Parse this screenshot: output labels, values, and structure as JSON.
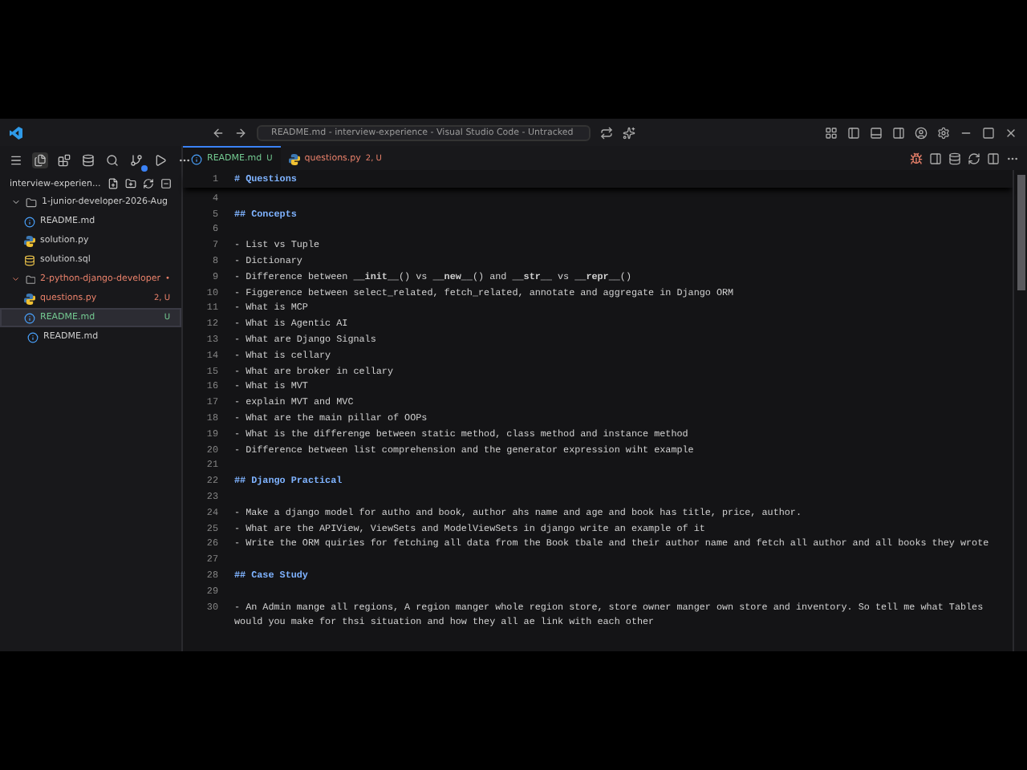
{
  "title_bar": {
    "command_center": "README.md - interview-experience - Visual Studio Code - Untracked"
  },
  "explorer": {
    "title": "interview-experien...",
    "tree": [
      {
        "name": "1-junior-developer-2026-Aug",
        "kind": "folder",
        "expanded": true,
        "selected": false,
        "children": [
          {
            "name": "README.md",
            "kind": "md",
            "selected": false
          },
          {
            "name": "solution.py",
            "kind": "py",
            "selected": false
          },
          {
            "name": "solution.sql",
            "kind": "sql",
            "selected": false
          }
        ]
      },
      {
        "name": "2-python-django-developer",
        "kind": "folder",
        "expanded": true,
        "color": "#e8806a",
        "badge": "•",
        "selected": false,
        "children": [
          {
            "name": "questions.py",
            "kind": "py",
            "color": "#e8806a",
            "badge": "2, U",
            "selected": false
          },
          {
            "name": "README.md",
            "kind": "md",
            "color": "#73c991",
            "badge": "U",
            "selected": true
          }
        ]
      },
      {
        "name": "README.md",
        "kind": "md",
        "selected": false
      }
    ]
  },
  "tabs": [
    {
      "label": "README.md",
      "badge": "U",
      "kind": "md",
      "color": "#73c991",
      "selected": true
    },
    {
      "label": "questions.py",
      "badge": "2, U",
      "kind": "py",
      "color": "#e8806a",
      "selected": false
    }
  ],
  "editor": {
    "sticky": {
      "number": "1",
      "kind": "heading",
      "text": "# Questions"
    },
    "lines": [
      {
        "number": "4",
        "kind": "blank"
      },
      {
        "number": "5",
        "kind": "heading",
        "text": "## Concepts"
      },
      {
        "number": "6",
        "kind": "blank"
      },
      {
        "number": "7",
        "kind": "text",
        "text": "- List vs Tuple"
      },
      {
        "number": "8",
        "kind": "text",
        "text": "- Dictionary"
      },
      {
        "number": "9",
        "kind": "text",
        "text": "- Difference between **__init__**() vs **__new__**() and **__str__** vs **__repr__**()"
      },
      {
        "number": "10",
        "kind": "text",
        "text": "- Figgerence between select_related, fetch_related, annotate and aggregate in Django ORM"
      },
      {
        "number": "11",
        "kind": "text",
        "text": "- What is MCP"
      },
      {
        "number": "12",
        "kind": "text",
        "text": "- What is Agentic AI"
      },
      {
        "number": "13",
        "kind": "text",
        "text": "- What are Django Signals"
      },
      {
        "number": "14",
        "kind": "text",
        "text": "- What is cellary"
      },
      {
        "number": "15",
        "kind": "text",
        "text": "- What are broker in cellary"
      },
      {
        "number": "16",
        "kind": "text",
        "text": "- What is MVT"
      },
      {
        "number": "17",
        "kind": "text",
        "text": "- explain MVT and MVC"
      },
      {
        "number": "18",
        "kind": "text",
        "text": "- What are the main pillar of OOPs"
      },
      {
        "number": "19",
        "kind": "text",
        "text": "- What is the differenge between static method, class method and instance method"
      },
      {
        "number": "20",
        "kind": "text",
        "text": "- Difference between list comprehension and the generator expression wiht example"
      },
      {
        "number": "21",
        "kind": "blank"
      },
      {
        "number": "22",
        "kind": "heading",
        "text": "## Django Practical"
      },
      {
        "number": "23",
        "kind": "blank"
      },
      {
        "number": "24",
        "kind": "text",
        "text": "- Make a django model for autho and book, author ahs name and age and book has title, price, author."
      },
      {
        "number": "25",
        "kind": "text",
        "text": "- What are the APIView, ViewSets and ModelViewSets in django write an example of it"
      },
      {
        "number": "26",
        "kind": "text",
        "text": "- Write the ORM quiries for fetching all data from the Book tbale and their author name and fetch all author and all books they wrote"
      },
      {
        "number": "27",
        "kind": "blank"
      },
      {
        "number": "28",
        "kind": "heading",
        "text": "## Case Study"
      },
      {
        "number": "29",
        "kind": "blank"
      },
      {
        "number": "30",
        "kind": "text",
        "text": "- An Admin mange all regions, A region manger whole region store, store owner manger own store and inventory. So tell me what Tables would you make for thsi situation and how they all ae link with each other"
      }
    ]
  }
}
